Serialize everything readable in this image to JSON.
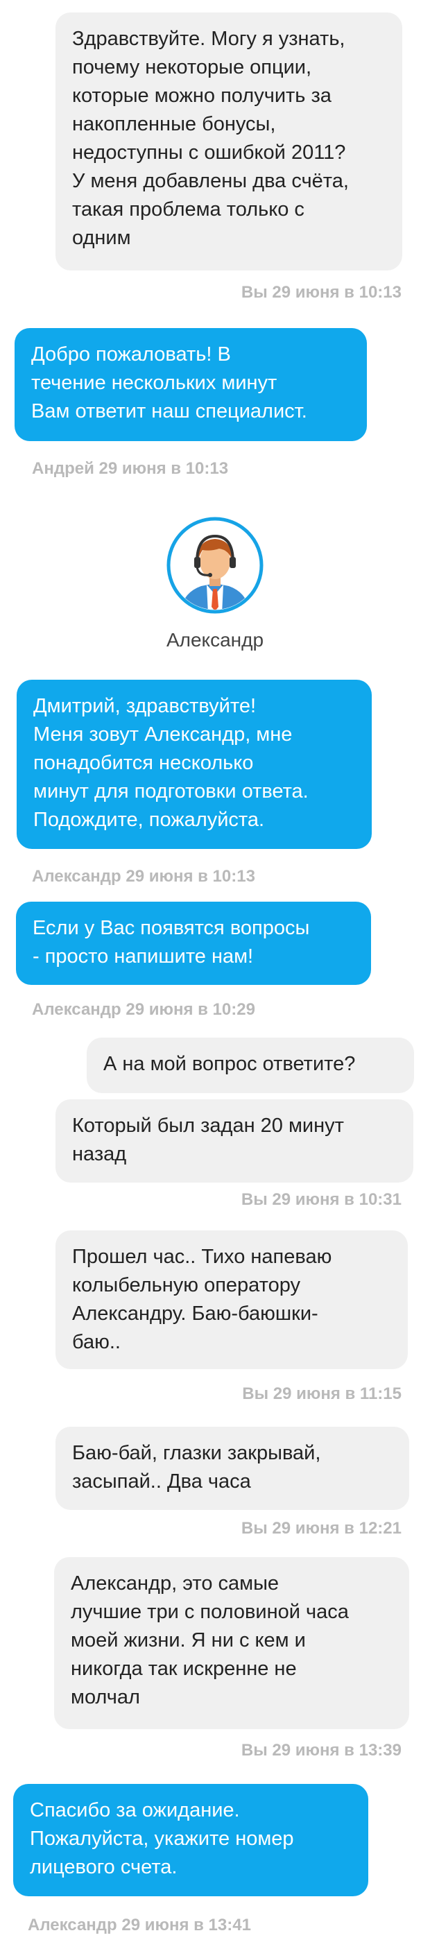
{
  "messages": [
    {
      "text": "Здравствуйте. Могу я узнать,\nпочему некоторые опции,\nкоторые можно получить за\nнакопленные бонусы,\nнедоступны с ошибкой 2011?\nУ меня добавлены два счёта,\nтакая проблема только с\nодним",
      "meta": "Вы 29 июня в 10:13"
    },
    {
      "text": "Добро пожаловать! В\nтечение нескольких минут\nВам ответит наш специалист.",
      "meta": "Андрей 29 июня в 10:13"
    },
    {
      "text": "Дмитрий, здравствуйте!\nМеня зовут Александр, мне\nпонадобится несколько\nминут для подготовки ответа.\nПодождите, пожалуйста.",
      "meta": "Александр 29 июня в 10:13"
    },
    {
      "text": "Если у Вас появятся вопросы\n- просто напишите нам!",
      "meta": "Александр 29 июня в 10:29"
    },
    {
      "text": "А на мой вопрос ответите?"
    },
    {
      "text": "Который был задан 20 минут\nназад",
      "meta": "Вы 29 июня в 10:31"
    },
    {
      "text": "Прошел час.. Тихо напеваю\nколыбельную оператору\nАлександру. Баю-баюшки-\nбаю..",
      "meta": "Вы 29 июня в 11:15"
    },
    {
      "text": "Баю-бай, глазки закрывай,\nзасыпай.. Два часа",
      "meta": "Вы 29 июня в 12:21"
    },
    {
      "text": "Александр, это самые\nлучшие три с половиной часа\nмоей жизни. Я ни с кем и\nникогда так искренне не\nмолчал",
      "meta": "Вы 29 июня в 13:39"
    },
    {
      "text": "Спасибо за ожидание.\nПожалуйста, укажите номер\nлицевого счета.",
      "meta": "Александр 29 июня в 13:41"
    }
  ],
  "agent": {
    "name": "Александр",
    "avatar_icon": "operator-headset-avatar-icon"
  },
  "colors": {
    "operator_bubble": "#10a8ec",
    "user_bubble": "#f0f0f0",
    "meta_text": "#b9b9b9"
  }
}
